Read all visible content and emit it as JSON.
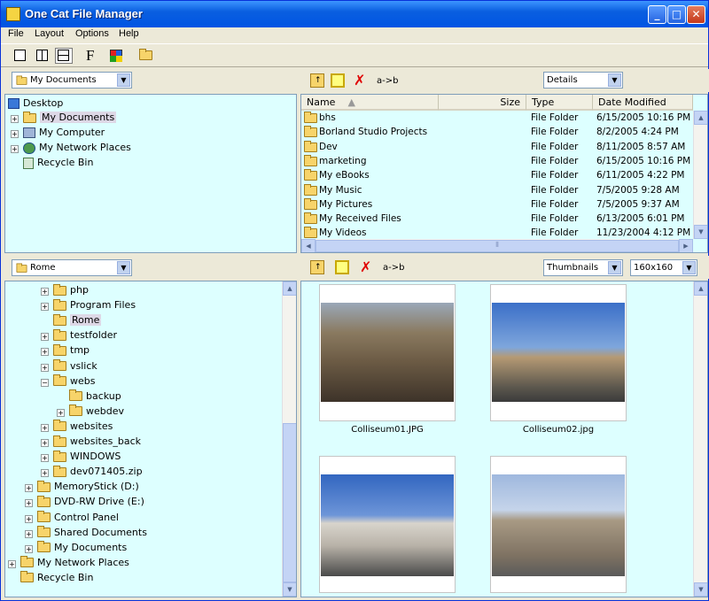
{
  "window": {
    "title": "One Cat File Manager"
  },
  "menu": [
    "File",
    "Layout",
    "Options",
    "Help"
  ],
  "toolbar": {
    "font_label": "F"
  },
  "top_left": {
    "combo": "My Documents",
    "tree": [
      "Desktop",
      "My Documents",
      "My Computer",
      "My Network Places",
      "Recycle Bin"
    ]
  },
  "top_right": {
    "copy_label": "a->b",
    "view": "Details",
    "headers": {
      "name": "Name",
      "size": "Size",
      "type": "Type",
      "date": "Date Modified"
    },
    "rows": [
      {
        "name": "bhs",
        "type": "File Folder",
        "date": "6/15/2005 10:16 PM"
      },
      {
        "name": "Borland Studio Projects",
        "type": "File Folder",
        "date": "8/2/2005 4:24 PM"
      },
      {
        "name": "Dev",
        "type": "File Folder",
        "date": "8/11/2005 8:57 AM"
      },
      {
        "name": "marketing",
        "type": "File Folder",
        "date": "6/15/2005 10:16 PM"
      },
      {
        "name": "My eBooks",
        "type": "File Folder",
        "date": "6/11/2005 4:22 PM"
      },
      {
        "name": "My Music",
        "type": "File Folder",
        "date": "7/5/2005 9:28 AM"
      },
      {
        "name": "My Pictures",
        "type": "File Folder",
        "date": "7/5/2005 9:37 AM"
      },
      {
        "name": "My Received Files",
        "type": "File Folder",
        "date": "6/13/2005 6:01 PM"
      },
      {
        "name": "My Videos",
        "type": "File Folder",
        "date": "11/23/2004 4:12 PM"
      }
    ]
  },
  "bottom_left": {
    "combo": "Rome",
    "tree": [
      "php",
      "Program Files",
      "Rome",
      "testfolder",
      "tmp",
      "vslick",
      "webs",
      "backup",
      "webdev",
      "websites",
      "websites_back",
      "WINDOWS",
      "dev071405.zip",
      "MemoryStick (D:)",
      "DVD-RW Drive (E:)",
      "Control Panel",
      "Shared Documents",
      "My Documents",
      "My Network Places",
      "Recycle Bin"
    ]
  },
  "bottom_right": {
    "copy_label": "a->b",
    "view": "Thumbnails",
    "size": "160x160",
    "thumbs": [
      "Colliseum01.JPG",
      "Colliseum02.jpg",
      "",
      ""
    ]
  },
  "colors": {
    "panel": "#ddffff",
    "title": "#0054e3"
  }
}
